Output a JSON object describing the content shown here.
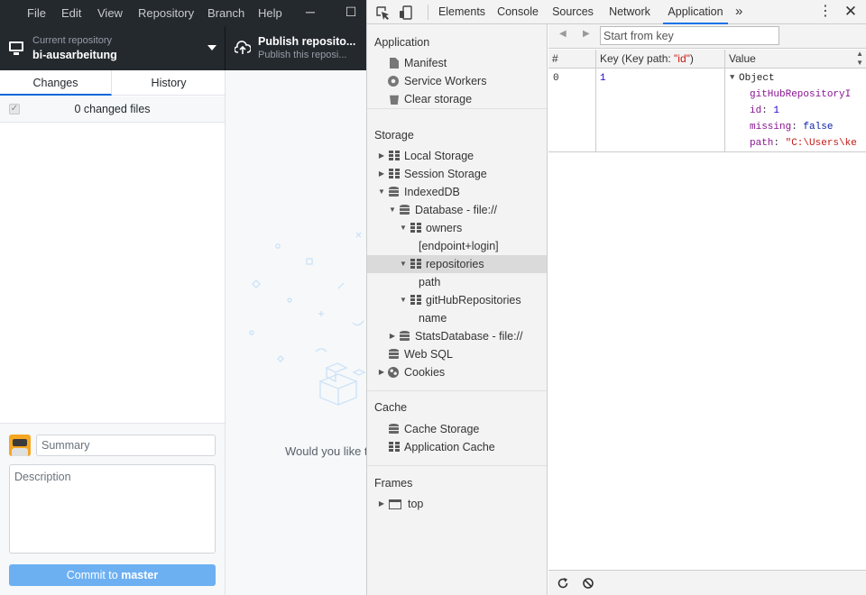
{
  "github_desktop": {
    "menu": [
      "File",
      "Edit",
      "View",
      "Repository",
      "Branch",
      "Help"
    ],
    "window_controls": {
      "minimize": "─",
      "maximize": "☐"
    },
    "current_repo": {
      "label": "Current repository",
      "name": "bi-ausarbeitung"
    },
    "publish": {
      "title": "Publish reposito...",
      "subtitle": "Publish this reposi..."
    },
    "tabs": {
      "changes": "Changes",
      "history": "History"
    },
    "changed_files": "0 changed files",
    "commit": {
      "summary_placeholder": "Summary",
      "description_placeholder": "Description",
      "button_prefix": "Commit to ",
      "branch": "master"
    },
    "blank_message": "Would you like to"
  },
  "devtools": {
    "tabs": [
      "Elements",
      "Console",
      "Sources",
      "Network",
      "Application"
    ],
    "active_tab": "Application",
    "more_tabs": "»",
    "menu_icon": "⋮",
    "close_icon": "✕",
    "sidebar": {
      "application": {
        "title": "Application",
        "items": [
          "Manifest",
          "Service Workers",
          "Clear storage"
        ]
      },
      "storage": {
        "title": "Storage",
        "local_storage": "Local Storage",
        "session_storage": "Session Storage",
        "indexeddb": "IndexedDB",
        "database": "Database - file://",
        "owners": "owners",
        "owners_index": "[endpoint+login]",
        "repositories": "repositories",
        "repositories_index": "path",
        "github_repositories": "gitHubRepositories",
        "github_repositories_index": "name",
        "stats_database": "StatsDatabase - file://",
        "web_sql": "Web SQL",
        "cookies": "Cookies"
      },
      "cache": {
        "title": "Cache",
        "items": [
          "Cache Storage",
          "Application Cache"
        ]
      },
      "frames": {
        "title": "Frames",
        "top": "top"
      }
    },
    "main": {
      "start_key_placeholder": "Start from key",
      "columns": {
        "index": "#",
        "key_prefix": "Key (Key path: ",
        "key_path": "\"id\"",
        "key_suffix": ")",
        "value": "Value"
      },
      "row": {
        "index": "0",
        "key": "1",
        "value_type": "Object",
        "props": [
          {
            "name": "gitHubRepositoryI",
            "sep": "",
            "value": "",
            "kind": "key"
          },
          {
            "name": "id",
            "sep": ": ",
            "value": "1",
            "kind": "num"
          },
          {
            "name": "missing",
            "sep": ": ",
            "value": "false",
            "kind": "bool"
          },
          {
            "name": "path",
            "sep": ": ",
            "value": "\"C:\\Users\\ke",
            "kind": "str"
          }
        ]
      }
    }
  }
}
